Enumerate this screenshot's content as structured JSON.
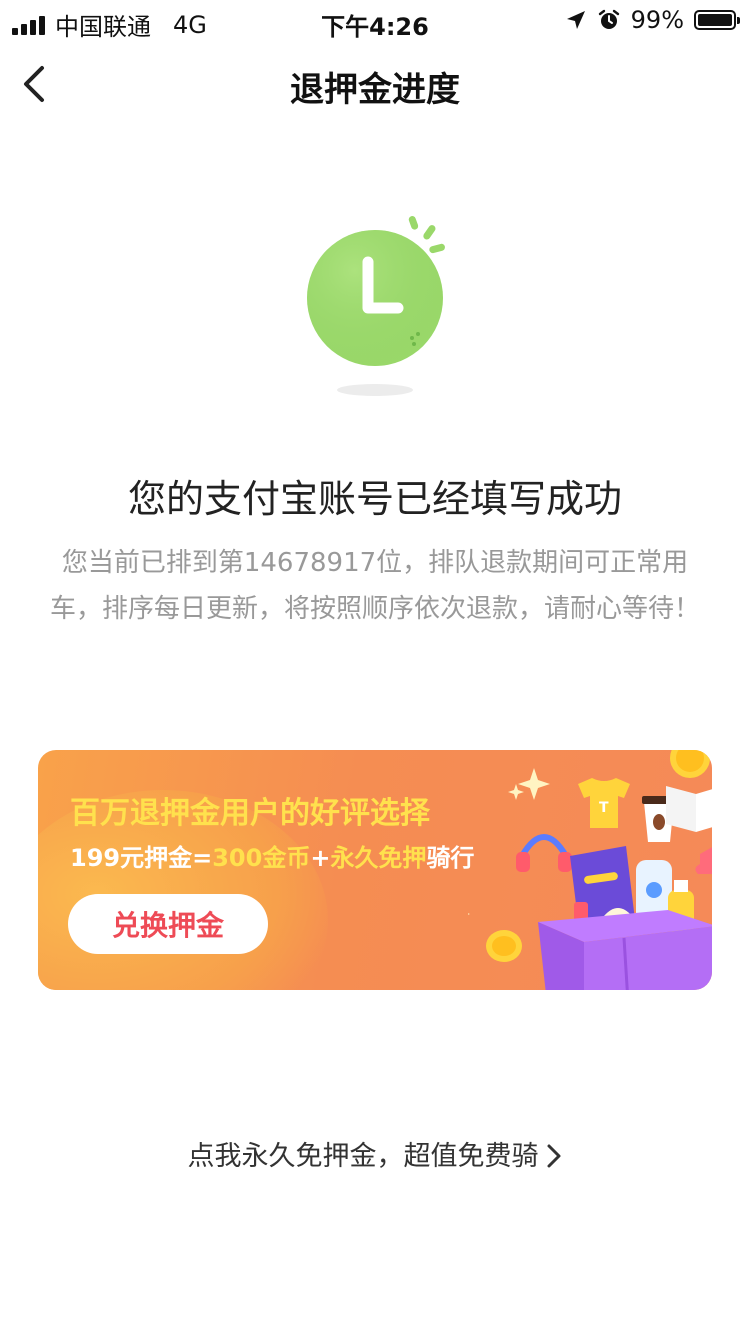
{
  "status_bar": {
    "carrier": "中国联通",
    "network": "4G",
    "time": "下午4:26",
    "battery": "99%",
    "battery_level": 0.99,
    "icons": [
      "signal-icon",
      "location-arrow-icon",
      "alarm-icon",
      "battery-icon"
    ]
  },
  "nav": {
    "title": "退押金进度",
    "back_icon": "chevron-left-icon"
  },
  "illustration": {
    "icon": "clock-icon",
    "accent": "#9ad86a"
  },
  "content": {
    "headline": "您的支付宝账号已经填写成功",
    "description": "您当前已排到第14678917位，排队退款期间可正常用车，排序每日更新，将按照顺序依次退款，请耐心等待！"
  },
  "banner": {
    "title": "百万退押金用户的好评选择",
    "subtitle_parts": [
      "199元押金=",
      "300金币",
      "+",
      "永久免押",
      "骑行"
    ],
    "button_label": "兑换押金",
    "colors": {
      "title": "#ffe14d",
      "button_text": "#ee4b56",
      "background": "#f58d52"
    }
  },
  "footer": {
    "link_label": "点我永久免押金，超值免费骑",
    "link_icon": "chevron-right-icon"
  }
}
